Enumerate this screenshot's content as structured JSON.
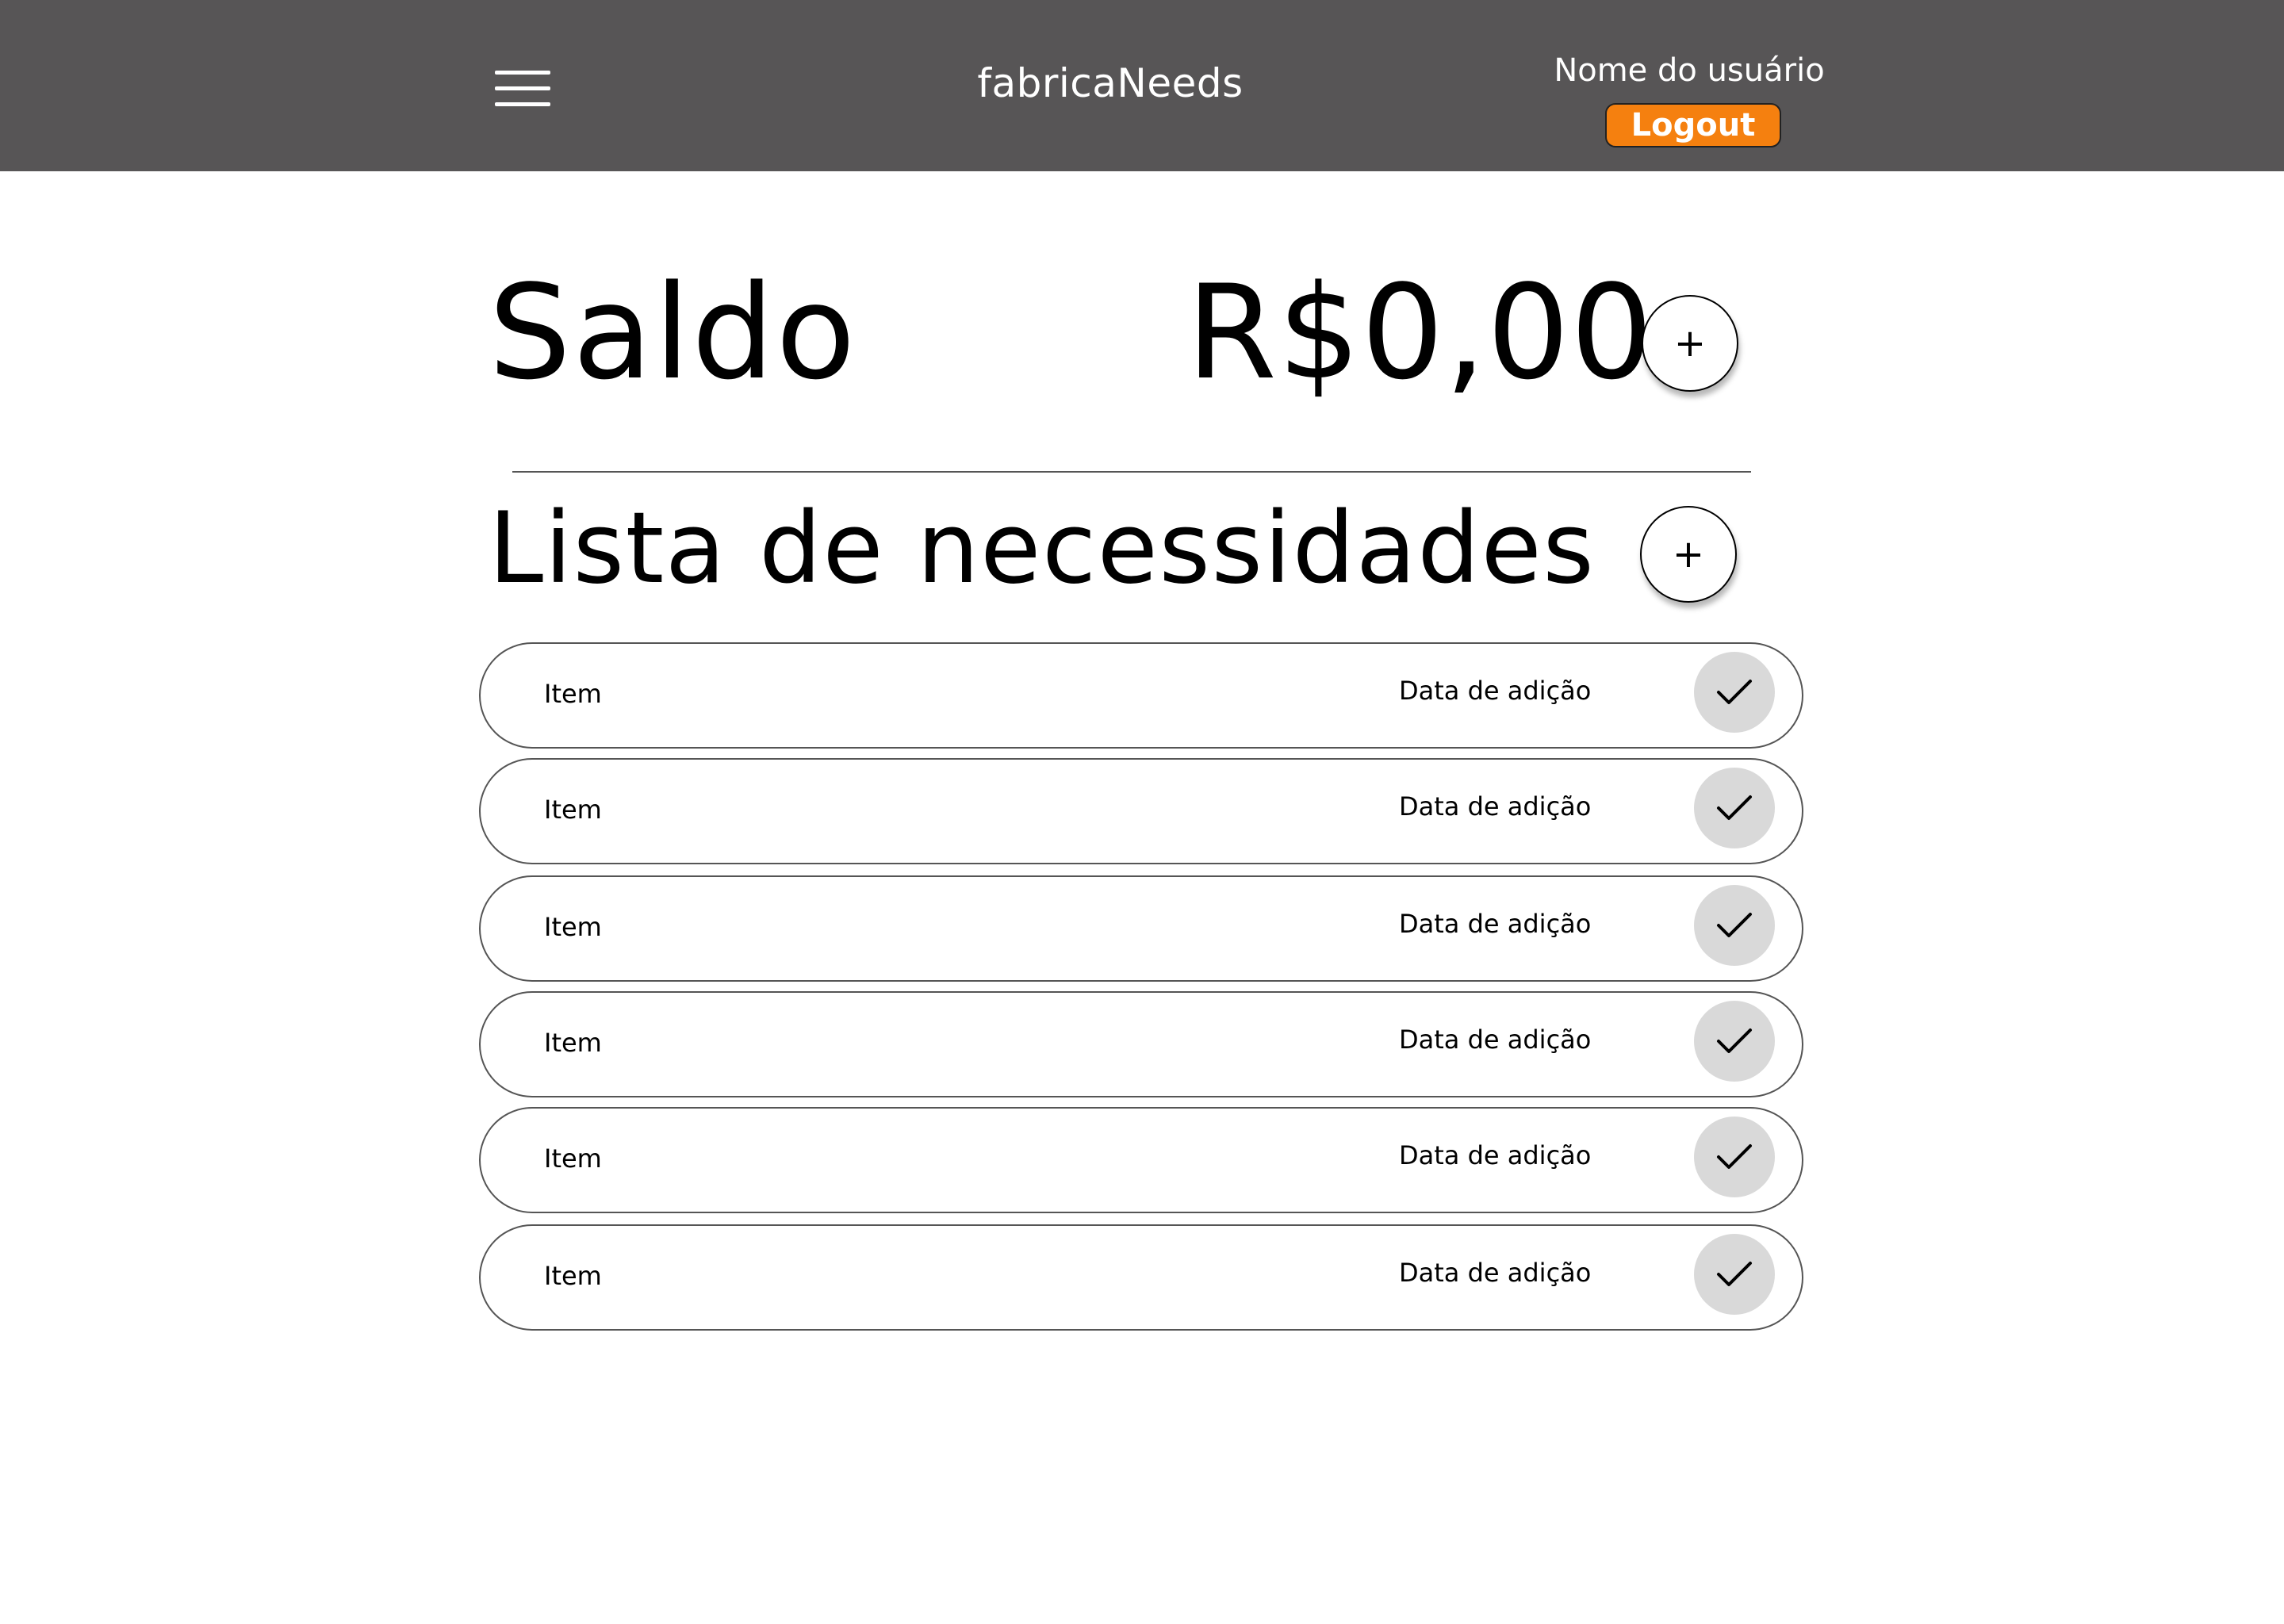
{
  "header": {
    "background": "#575556",
    "menu_icon": "hamburger-menu-icon",
    "app_title": "fabricaNeeds",
    "user_name": "Nome do usuário",
    "logout_label": "Logout",
    "logout_color": "#f5800f"
  },
  "balance": {
    "label": "Saldo",
    "value": "R$0,00",
    "add_symbol": "+"
  },
  "needs": {
    "title": "Lista de necessidades",
    "add_symbol": "+",
    "check_icon": "check-icon",
    "items": [
      {
        "name": "Item",
        "date": "Data de adição"
      },
      {
        "name": "Item",
        "date": "Data de adição"
      },
      {
        "name": "Item",
        "date": "Data de adição"
      },
      {
        "name": "Item",
        "date": "Data de adição"
      },
      {
        "name": "Item",
        "date": "Data de adição"
      },
      {
        "name": "Item",
        "date": "Data de adição"
      }
    ]
  }
}
